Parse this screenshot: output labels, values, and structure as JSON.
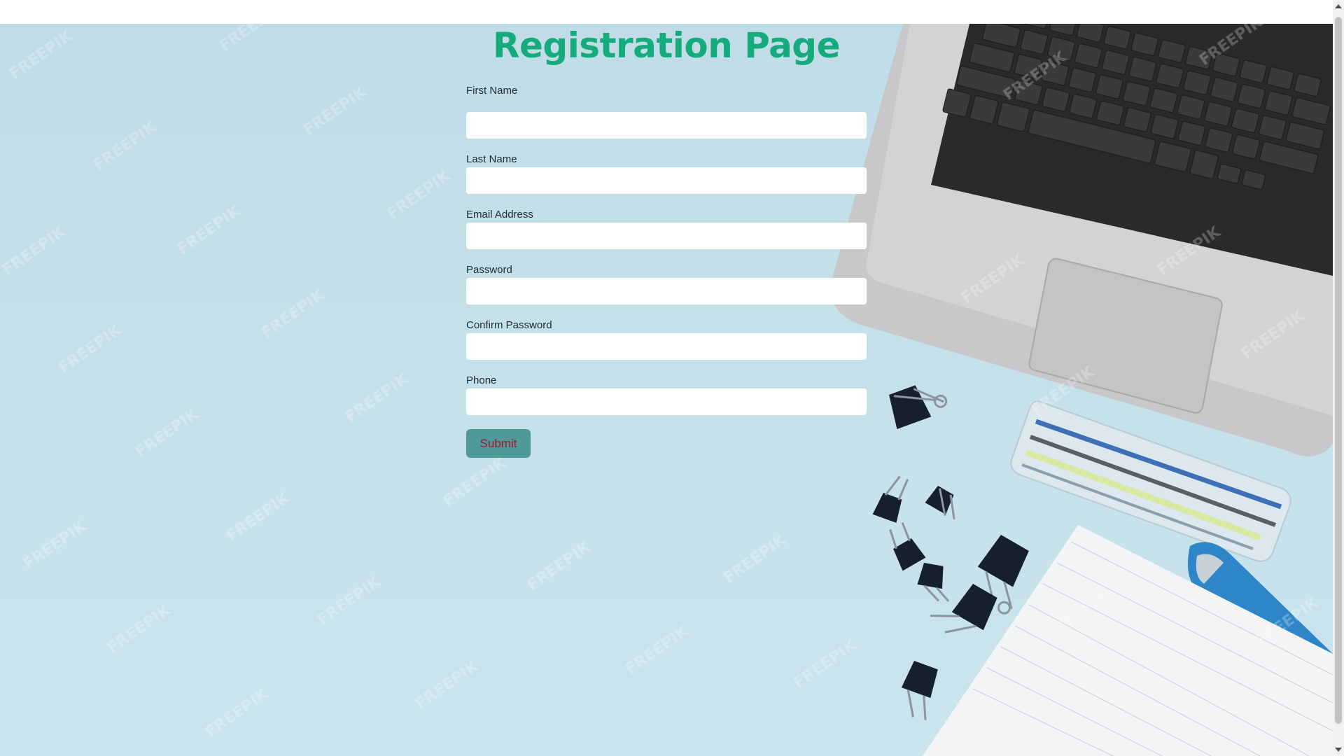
{
  "page": {
    "title": "Registration Page"
  },
  "form": {
    "fields": [
      {
        "label": "First Name",
        "value": "",
        "placeholder": ""
      },
      {
        "label": "Last Name",
        "value": "",
        "placeholder": ""
      },
      {
        "label": "Email Address",
        "value": "",
        "placeholder": ""
      },
      {
        "label": "Password",
        "value": "",
        "placeholder": ""
      },
      {
        "label": "Confirm Password",
        "value": "",
        "placeholder": ""
      },
      {
        "label": "Phone",
        "value": "",
        "placeholder": ""
      }
    ],
    "submit_label": "Submit"
  },
  "colors": {
    "title": "#16ab7c",
    "background": "#c3dfe8",
    "submit_bg": "#4f9a99",
    "submit_text": "#a3182a"
  },
  "background_image": {
    "icons": [
      "laptop-icon",
      "binder-clip-icon",
      "pencil-case-icon",
      "stapler-icon",
      "notebook-icon"
    ]
  }
}
